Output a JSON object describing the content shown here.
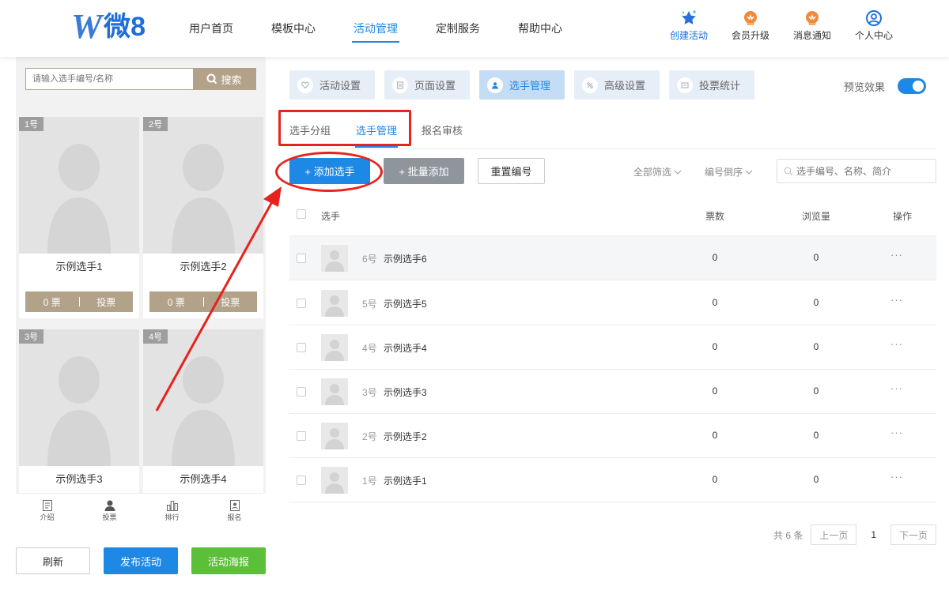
{
  "brand": {
    "logo_letter": "W",
    "logo_text": "微8"
  },
  "nav": [
    {
      "label": "用户首页"
    },
    {
      "label": "模板中心"
    },
    {
      "label": "活动管理"
    },
    {
      "label": "定制服务"
    },
    {
      "label": "帮助中心"
    }
  ],
  "header_actions": [
    {
      "label": "创建活动",
      "icon": "star-icon"
    },
    {
      "label": "会员升级",
      "icon": "vip-badge-icon"
    },
    {
      "label": "消息通知",
      "icon": "bell-badge-icon"
    },
    {
      "label": "个人中心",
      "icon": "user-circle-icon"
    }
  ],
  "preview_phone": {
    "search_placeholder": "请输入选手编号/名称",
    "search_button": "搜索",
    "cards": [
      {
        "num": "1号",
        "name": "示例选手1",
        "votes": "0 票",
        "vote_label": "投票"
      },
      {
        "num": "2号",
        "name": "示例选手2",
        "votes": "0 票",
        "vote_label": "投票"
      },
      {
        "num": "3号",
        "name": "示例选手3"
      },
      {
        "num": "4号",
        "name": "示例选手4"
      }
    ],
    "tabbar": [
      {
        "label": "介绍",
        "icon": "document-icon"
      },
      {
        "label": "投票",
        "icon": "person-icon"
      },
      {
        "label": "排行",
        "icon": "bar-chart-icon"
      },
      {
        "label": "报名",
        "icon": "id-card-icon"
      }
    ]
  },
  "bottom_buttons": {
    "refresh": "刷新",
    "publish": "发布活动",
    "poster": "活动海报"
  },
  "steps": [
    {
      "label": "活动设置",
      "icon": "heart-icon"
    },
    {
      "label": "页面设置",
      "icon": "page-icon"
    },
    {
      "label": "选手管理",
      "icon": "user-icon"
    },
    {
      "label": "高级设置",
      "icon": "percent-icon"
    },
    {
      "label": "投票统计",
      "icon": "stats-icon"
    }
  ],
  "preview_toggle": {
    "label": "预览效果",
    "on": true
  },
  "sub_tabs": [
    {
      "label": "选手分组"
    },
    {
      "label": "选手管理"
    },
    {
      "label": "报名审核"
    }
  ],
  "toolbar": {
    "add": "+ 添加选手",
    "batch": "+ 批量添加",
    "reset": "重置编号",
    "filter": "全部筛选",
    "sort": "编号倒序",
    "search_placeholder": "选手编号、名称、简介"
  },
  "table": {
    "columns": {
      "player": "选手",
      "votes": "票数",
      "views": "浏览量",
      "actions": "操作"
    },
    "rows": [
      {
        "num": "6号",
        "name": "示例选手6",
        "votes": "0",
        "views": "0"
      },
      {
        "num": "5号",
        "name": "示例选手5",
        "votes": "0",
        "views": "0"
      },
      {
        "num": "4号",
        "name": "示例选手4",
        "votes": "0",
        "views": "0"
      },
      {
        "num": "3号",
        "name": "示例选手3",
        "votes": "0",
        "views": "0"
      },
      {
        "num": "2号",
        "name": "示例选手2",
        "votes": "0",
        "views": "0"
      },
      {
        "num": "1号",
        "name": "示例选手1",
        "votes": "0",
        "views": "0"
      }
    ],
    "more_symbol": "···"
  },
  "pagination": {
    "total": "共 6 条",
    "prev": "上一页",
    "current": "1",
    "next": "下一页"
  },
  "colors": {
    "primary": "#1e88e5",
    "accent_tan": "#b2a28a",
    "annotation_red": "#e8221c",
    "green": "#5cbf3a"
  }
}
